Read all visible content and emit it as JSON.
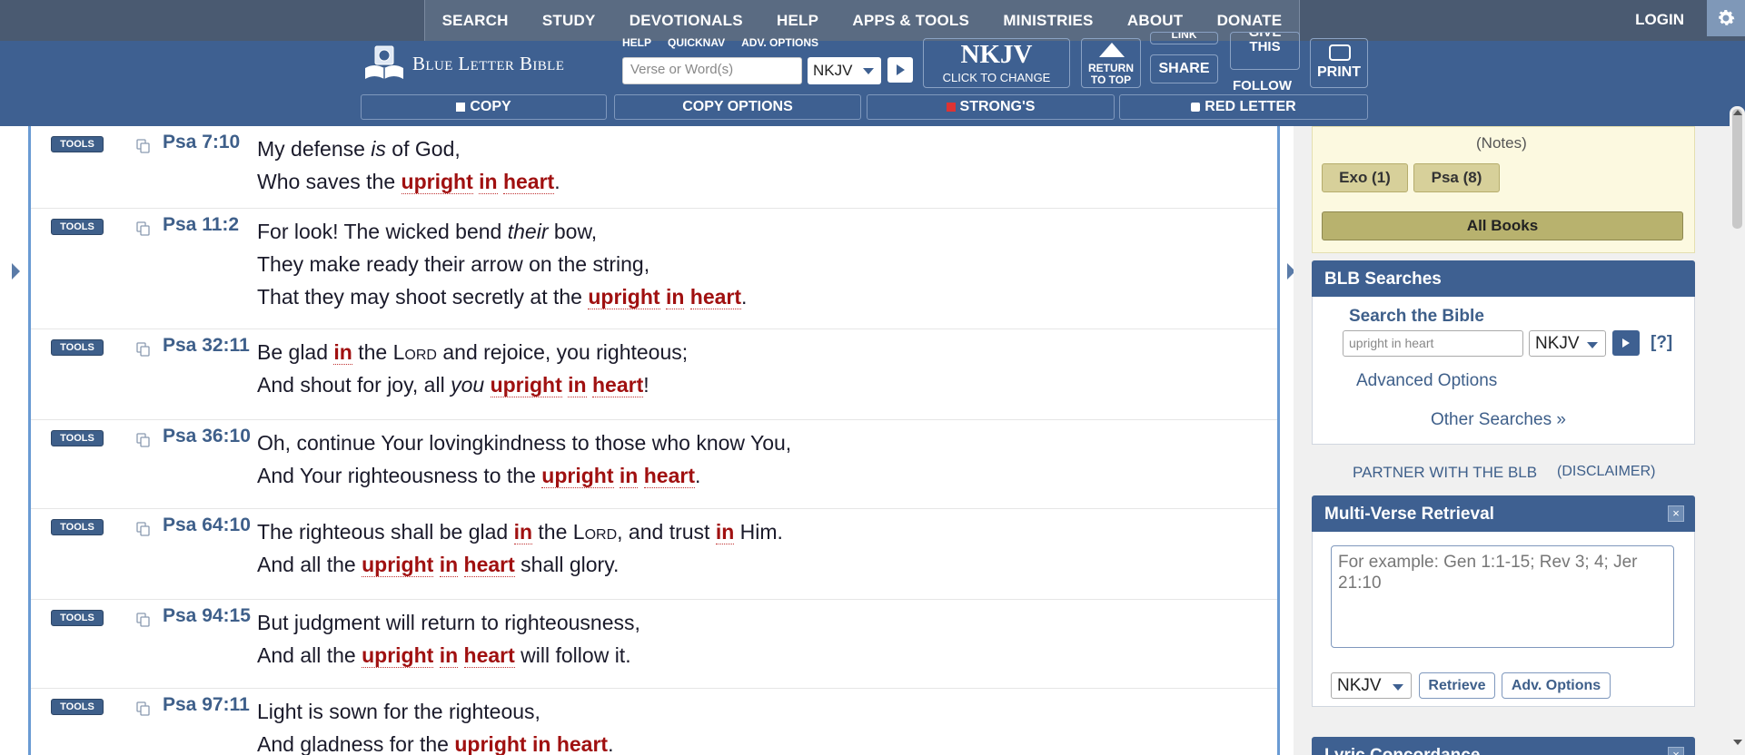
{
  "nav": {
    "items": [
      "SEARCH",
      "STUDY",
      "DEVOTIONALS",
      "HELP",
      "APPS & TOOLS",
      "MINISTRIES",
      "ABOUT",
      "DONATE"
    ],
    "login": "LOGIN"
  },
  "header": {
    "logo_text": "Blue Letter Bible",
    "links": [
      "HELP",
      "QUICKNAV",
      "ADV. OPTIONS"
    ],
    "search_placeholder": "Verse or Word(s)",
    "version": "NKJV",
    "version_big": "NKJV",
    "version_small": "CLICK TO CHANGE",
    "return_top_1": "RETURN",
    "return_top_2": "TO TOP",
    "link_label": "LINK",
    "share_label": "SHARE",
    "give_1": "GIVE",
    "give_2": "THIS",
    "follow_label": "FOLLOW",
    "print_label": "PRINT",
    "copy": "COPY",
    "copy_options": "COPY OPTIONS",
    "strongs": "STRONG'S",
    "red_letter": "RED LETTER"
  },
  "verses": [
    {
      "tools": "TOOLS",
      "ref": "Psa 7:10",
      "lines": [
        [
          {
            "t": "My defense "
          },
          {
            "t": "is",
            "i": true
          },
          {
            "t": " of God,"
          }
        ],
        [
          {
            "t": "Who saves the "
          },
          {
            "t": "upright",
            "h": true
          },
          {
            "t": " "
          },
          {
            "t": "in",
            "h": true
          },
          {
            "t": " "
          },
          {
            "t": "heart",
            "h": true
          },
          {
            "t": "."
          }
        ]
      ]
    },
    {
      "tools": "TOOLS",
      "ref": "Psa 11:2",
      "lines": [
        [
          {
            "t": "For look! The wicked bend "
          },
          {
            "t": "their",
            "i": true
          },
          {
            "t": " bow,"
          }
        ],
        [
          {
            "t": "They make ready their arrow on the string,"
          }
        ],
        [
          {
            "t": "That they may shoot secretly at the "
          },
          {
            "t": "upright",
            "h": true
          },
          {
            "t": " "
          },
          {
            "t": "in",
            "h": true
          },
          {
            "t": " "
          },
          {
            "t": "heart",
            "h": true
          },
          {
            "t": "."
          }
        ]
      ]
    },
    {
      "tools": "TOOLS",
      "ref": "Psa 32:11",
      "lines": [
        [
          {
            "t": "Be glad "
          },
          {
            "t": "in",
            "h": true
          },
          {
            "t": " the "
          },
          {
            "t": "Lord",
            "sc": true
          },
          {
            "t": " and rejoice, you righteous;"
          }
        ],
        [
          {
            "t": "And shout for joy, all "
          },
          {
            "t": "you",
            "i": true
          },
          {
            "t": " "
          },
          {
            "t": "upright",
            "h": true
          },
          {
            "t": " "
          },
          {
            "t": "in",
            "h": true
          },
          {
            "t": " "
          },
          {
            "t": "heart",
            "h": true
          },
          {
            "t": "!"
          }
        ]
      ]
    },
    {
      "tools": "TOOLS",
      "ref": "Psa 36:10",
      "lines": [
        [
          {
            "t": "Oh, continue Your lovingkindness to those who know You,"
          }
        ],
        [
          {
            "t": "And Your righteousness to the "
          },
          {
            "t": "upright",
            "h": true
          },
          {
            "t": " "
          },
          {
            "t": "in",
            "h": true
          },
          {
            "t": " "
          },
          {
            "t": "heart",
            "h": true
          },
          {
            "t": "."
          }
        ]
      ]
    },
    {
      "tools": "TOOLS",
      "ref": "Psa 64:10",
      "lines": [
        [
          {
            "t": "The righteous shall be glad "
          },
          {
            "t": "in",
            "h": true
          },
          {
            "t": " the "
          },
          {
            "t": "Lord",
            "sc": true
          },
          {
            "t": ", and trust "
          },
          {
            "t": "in",
            "h": true
          },
          {
            "t": " Him."
          }
        ],
        [
          {
            "t": "And all the "
          },
          {
            "t": "upright",
            "h": true
          },
          {
            "t": " "
          },
          {
            "t": "in",
            "h": true
          },
          {
            "t": " "
          },
          {
            "t": "heart",
            "h": true
          },
          {
            "t": " shall glory."
          }
        ]
      ]
    },
    {
      "tools": "TOOLS",
      "ref": "Psa 94:15",
      "lines": [
        [
          {
            "t": "But judgment will return to righteousness,"
          }
        ],
        [
          {
            "t": "And all the "
          },
          {
            "t": "upright",
            "h": true
          },
          {
            "t": " "
          },
          {
            "t": "in",
            "h": true
          },
          {
            "t": " "
          },
          {
            "t": "heart",
            "h": true
          },
          {
            "t": " will follow it."
          }
        ]
      ]
    },
    {
      "tools": "TOOLS",
      "ref": "Psa 97:11",
      "lines": [
        [
          {
            "t": "Light is sown for the righteous,"
          }
        ],
        [
          {
            "t": "And gladness for the "
          },
          {
            "t": "upright",
            "h": true
          },
          {
            "t": " "
          },
          {
            "t": "in",
            "h": true
          },
          {
            "t": " "
          },
          {
            "t": "heart",
            "h": true
          },
          {
            "t": "."
          }
        ]
      ]
    }
  ],
  "sidebar": {
    "notes": "(Notes)",
    "book_buttons": [
      "Exo (1)",
      "Psa (8)"
    ],
    "all_books": "All Books",
    "blb_searches": "BLB Searches",
    "search_title": "Search the Bible",
    "search_value": "upright in heart",
    "search_version": "NKJV",
    "help": "[?]",
    "advanced_options": "Advanced Options",
    "other_searches": "Other Searches »",
    "partner": "PARTNER WITH THE BLB",
    "disclaimer": "(DISCLAIMER)",
    "multi_verse_title": "Multi-Verse Retrieval",
    "multi_verse_placeholder": "For example: Gen 1:1-15; Rev 3; 4; Jer 21:10",
    "multi_version": "NKJV",
    "retrieve": "Retrieve",
    "adv_options": "Adv. Options",
    "next_panel": "Lyric Concordance"
  }
}
